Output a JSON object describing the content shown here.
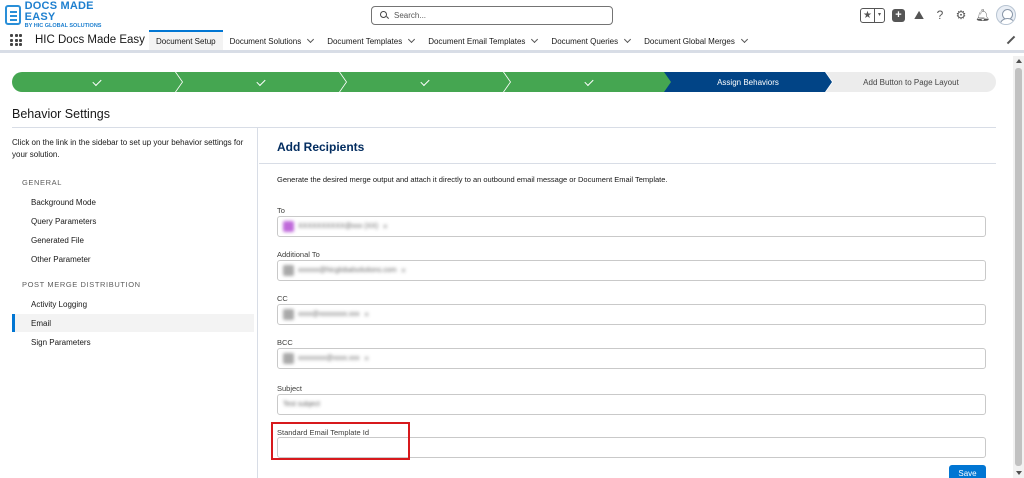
{
  "header": {
    "logo_title": "DOCS MADE EASY",
    "logo_subtitle": "BY HIC GLOBAL SOLUTIONS",
    "search_placeholder": "Search...",
    "icons": [
      "favorites-star-icon",
      "add-icon",
      "trailhead-icon",
      "help-icon",
      "setup-gear-icon",
      "notifications-bell-icon",
      "user-avatar"
    ]
  },
  "nav": {
    "app_name": "HIC Docs Made Easy",
    "tabs": [
      {
        "label": "Document Setup",
        "active": true,
        "has_menu": false
      },
      {
        "label": "Document Solutions",
        "has_menu": true
      },
      {
        "label": "Document Templates",
        "has_menu": true
      },
      {
        "label": "Document Email Templates",
        "has_menu": true
      },
      {
        "label": "Document Queries",
        "has_menu": true
      },
      {
        "label": "Document Global Merges",
        "has_menu": true
      }
    ]
  },
  "path": {
    "steps": [
      {
        "label": "",
        "status": "complete"
      },
      {
        "label": "",
        "status": "complete"
      },
      {
        "label": "",
        "status": "complete"
      },
      {
        "label": "",
        "status": "complete"
      },
      {
        "label": "",
        "status": "complete"
      },
      {
        "label": "Assign Behaviors",
        "status": "current"
      },
      {
        "label": "Add Button to Page Layout",
        "status": "incomplete"
      }
    ],
    "colors": {
      "complete": "#45a651",
      "current": "#014486",
      "incomplete": "#ececec"
    }
  },
  "page": {
    "title": "Behavior Settings"
  },
  "sidebar": {
    "intro": "Click on the link in the sidebar to set up your behavior settings for your solution.",
    "sections": [
      {
        "heading": "GENERAL",
        "items": [
          {
            "label": "Background Mode"
          },
          {
            "label": "Query Parameters"
          },
          {
            "label": "Generated File"
          },
          {
            "label": "Other Parameter"
          }
        ]
      },
      {
        "heading": "POST MERGE DISTRIBUTION",
        "items": [
          {
            "label": "Activity Logging"
          },
          {
            "label": "Email",
            "active": true
          },
          {
            "label": "Sign Parameters"
          }
        ]
      }
    ]
  },
  "main": {
    "title": "Add Recipients",
    "description": "Generate the desired merge output and attach it directly to an outbound email message or Document Email Template.",
    "fields": {
      "to": {
        "label": "To",
        "pill": "XXXXXXXXXX@xxx (XX)",
        "pill_color": "#b44fd4"
      },
      "additional_to": {
        "label": "Additional To",
        "pill": "xxxxxx@hicglobalsolutions.com",
        "pill_color": "#9b9b9b"
      },
      "cc": {
        "label": "CC",
        "pill": "xxxx@xxxxxxxx.xxx",
        "pill_color": "#9b9b9b"
      },
      "bcc": {
        "label": "BCC",
        "pill": "xxxxxxxx@xxxx.xxx",
        "pill_color": "#9b9b9b"
      },
      "subject": {
        "label": "Subject",
        "value": "Test subject"
      },
      "template_id": {
        "label": "Standard Email Template Id",
        "value": ""
      }
    },
    "save_label": "Save",
    "highlight_color": "#d7191c"
  }
}
